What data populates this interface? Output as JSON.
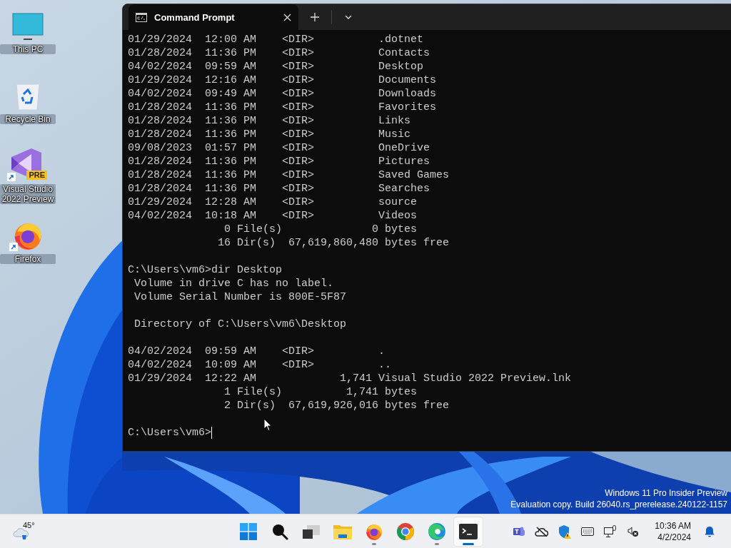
{
  "desktop": {
    "icons": [
      {
        "kind": "monitor",
        "label": "This PC",
        "shortcut": false
      },
      {
        "kind": "recycle-bin",
        "label": "Recycle Bin",
        "shortcut": false
      },
      {
        "kind": "visual-studio",
        "label": "Visual Studio 2022 Preview",
        "badge": "PRE",
        "shortcut": true
      },
      {
        "kind": "firefox",
        "label": "Firefox",
        "shortcut": true
      }
    ],
    "build_notice": {
      "line_1": "Windows 11 Pro Insider Preview",
      "line_2": "Evaluation copy. Build 26040.rs_prerelease.240122-1157"
    }
  },
  "terminal": {
    "tabs": [
      {
        "title": "Command Prompt",
        "selected": true
      }
    ],
    "blocks": [
      [
        "01/29/2024  12:00 AM    <DIR>          .dotnet",
        "01/28/2024  11:36 PM    <DIR>          Contacts",
        "04/02/2024  09:59 AM    <DIR>          Desktop",
        "01/29/2024  12:16 AM    <DIR>          Documents",
        "04/02/2024  09:49 AM    <DIR>          Downloads",
        "01/28/2024  11:36 PM    <DIR>          Favorites",
        "01/28/2024  11:36 PM    <DIR>          Links",
        "01/28/2024  11:36 PM    <DIR>          Music",
        "09/08/2023  01:57 PM    <DIR>          OneDrive",
        "01/28/2024  11:36 PM    <DIR>          Pictures",
        "01/28/2024  11:36 PM    <DIR>          Saved Games",
        "01/28/2024  11:36 PM    <DIR>          Searches",
        "01/29/2024  12:28 AM    <DIR>          source",
        "04/02/2024  10:18 AM    <DIR>          Videos",
        "               0 File(s)              0 bytes",
        "              16 Dir(s)  67,619,860,480 bytes free"
      ],
      [
        "C:\\Users\\vm6>dir Desktop",
        " Volume in drive C has no label.",
        " Volume Serial Number is 800E-5F87"
      ],
      [
        " Directory of C:\\Users\\vm6\\Desktop"
      ],
      [
        "04/02/2024  09:59 AM    <DIR>          .",
        "04/02/2024  10:09 AM    <DIR>          ..",
        "01/29/2024  12:22 AM             1,741 Visual Studio 2022 Preview.lnk",
        "               1 File(s)          1,741 bytes",
        "               2 Dir(s)  67,619,926,016 bytes free"
      ],
      [
        "C:\\Users\\vm6>"
      ]
    ],
    "cursor": true
  },
  "taskbar": {
    "weather": {
      "temperature": "45°"
    },
    "apps": [
      {
        "kind": "start",
        "running": false,
        "selected": false
      },
      {
        "kind": "search",
        "running": false,
        "selected": false
      },
      {
        "kind": "task-view",
        "running": false,
        "selected": false
      },
      {
        "kind": "file-explorer",
        "running": false,
        "selected": false
      },
      {
        "kind": "firefox",
        "running": true,
        "selected": false
      },
      {
        "kind": "chrome",
        "running": false,
        "selected": false
      },
      {
        "kind": "edge",
        "running": true,
        "selected": false
      },
      {
        "kind": "terminal",
        "running": true,
        "selected": true
      }
    ],
    "clock": {
      "time": "10:36 AM",
      "date": "4/2/2024"
    }
  }
}
